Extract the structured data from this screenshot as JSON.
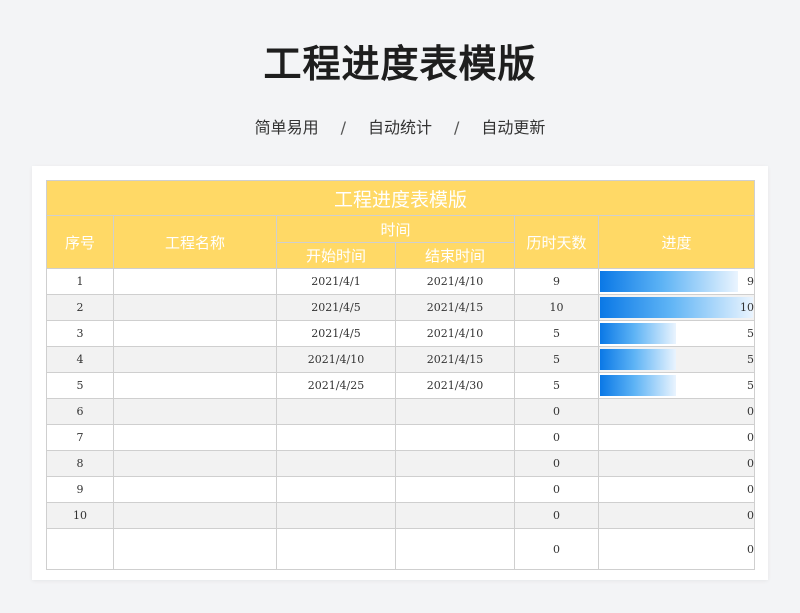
{
  "page": {
    "title": "工程进度表模版",
    "tags": [
      "简单易用",
      "自动统计",
      "自动更新"
    ],
    "separator": "/"
  },
  "sheet": {
    "title": "工程进度表模版",
    "headers": {
      "index": "序号",
      "name": "工程名称",
      "time": "时间",
      "start": "开始时间",
      "end": "结束时间",
      "days": "历时天数",
      "progress": "进度"
    },
    "progress_max": 10,
    "rows": [
      {
        "index": "1",
        "name": "",
        "start": "2021/4/1",
        "end": "2021/4/10",
        "days": "9",
        "progress": 9
      },
      {
        "index": "2",
        "name": "",
        "start": "2021/4/5",
        "end": "2021/4/15",
        "days": "10",
        "progress": 10
      },
      {
        "index": "3",
        "name": "",
        "start": "2021/4/5",
        "end": "2021/4/10",
        "days": "5",
        "progress": 5
      },
      {
        "index": "4",
        "name": "",
        "start": "2021/4/10",
        "end": "2021/4/15",
        "days": "5",
        "progress": 5
      },
      {
        "index": "5",
        "name": "",
        "start": "2021/4/25",
        "end": "2021/4/30",
        "days": "5",
        "progress": 5
      },
      {
        "index": "6",
        "name": "",
        "start": "",
        "end": "",
        "days": "0",
        "progress": 0
      },
      {
        "index": "7",
        "name": "",
        "start": "",
        "end": "",
        "days": "0",
        "progress": 0
      },
      {
        "index": "8",
        "name": "",
        "start": "",
        "end": "",
        "days": "0",
        "progress": 0
      },
      {
        "index": "9",
        "name": "",
        "start": "",
        "end": "",
        "days": "0",
        "progress": 0
      },
      {
        "index": "10",
        "name": "",
        "start": "",
        "end": "",
        "days": "0",
        "progress": 0
      },
      {
        "index": "",
        "name": "",
        "start": "",
        "end": "",
        "days": "0",
        "progress": 0
      }
    ]
  },
  "colors": {
    "header_fill": "#ffd966",
    "header_text": "#ffffff",
    "bar_start": "#0a78e6",
    "bar_end": "#eaf4fe",
    "row_stripe": "#f2f2f2"
  }
}
